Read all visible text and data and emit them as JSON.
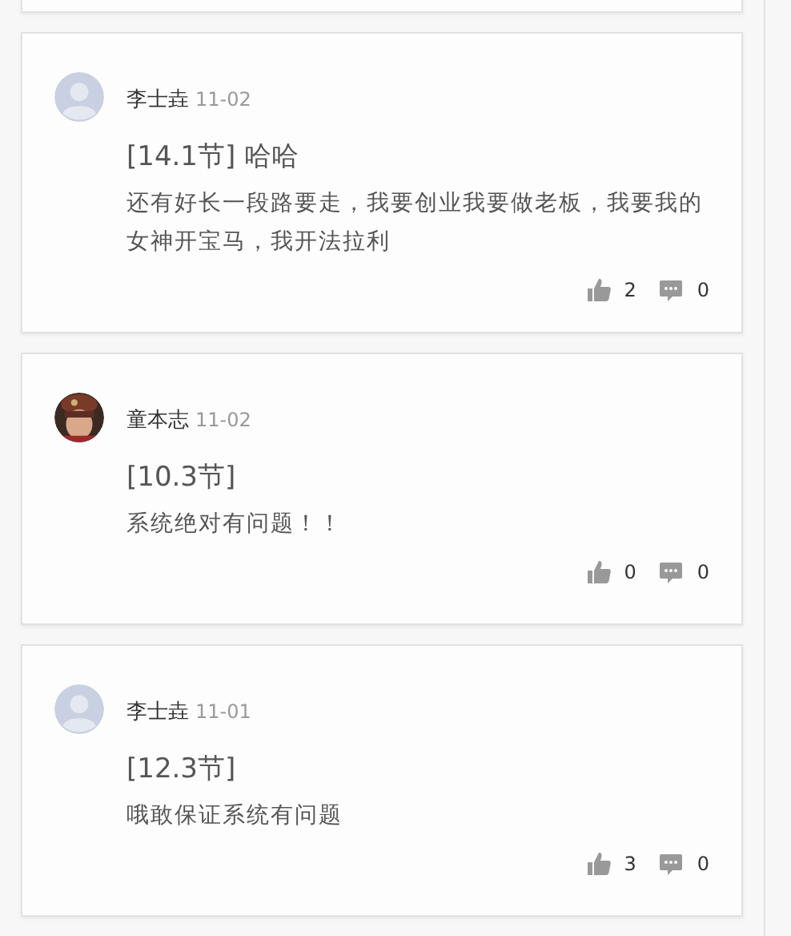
{
  "comments": [
    {
      "author": "李士垚",
      "date": "11-02",
      "avatar": {
        "kind": "default"
      },
      "title": "[14.1节] 哈哈",
      "body": "还有好长一段路要走，我要创业我要做老板，我要我的女神开宝马，我开法拉利",
      "likes": "2",
      "replies": "0"
    },
    {
      "author": "童本志",
      "date": "11-02",
      "title": "[10.3节]",
      "body": "系统绝对有问题！！",
      "likes": "0",
      "replies": "0"
    },
    {
      "author": "李士垚",
      "date": "11-01",
      "avatar": {
        "kind": "default"
      },
      "title": "[12.3节]",
      "body": "哦敢保证系统有问题",
      "likes": "3",
      "replies": "0"
    }
  ]
}
